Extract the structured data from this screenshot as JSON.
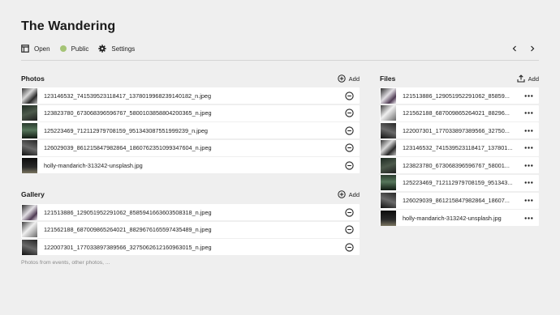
{
  "page": {
    "title": "The Wandering"
  },
  "toolbar": {
    "open_label": "Open",
    "public_label": "Public",
    "settings_label": "Settings",
    "status_color": "#a5c476"
  },
  "photos": {
    "title": "Photos",
    "add_label": "Add",
    "items": [
      {
        "name": "123146532_741539523118417_1378019968239140182_n.jpeg",
        "thumb": "t1"
      },
      {
        "name": "123823780_673068396596767_5800103858804200365_n.jpeg",
        "thumb": "t2"
      },
      {
        "name": "125223469_712112979708159_951343087551999239_n.jpeg",
        "thumb": "t3"
      },
      {
        "name": "126029039_861215847982864_1860762351099347604_n.jpeg",
        "thumb": "t4"
      },
      {
        "name": "holly-mandarich-313242-unsplash.jpg",
        "thumb": "t5"
      }
    ]
  },
  "gallery": {
    "title": "Gallery",
    "add_label": "Add",
    "caption": "Photos from events, other photos, ...",
    "items": [
      {
        "name": "121513886_129051952291062_8585941663603508318_n.jpeg",
        "thumb": "t6"
      },
      {
        "name": "121562188_687009865264021_8829676165597435489_n.jpeg",
        "thumb": "t7"
      },
      {
        "name": "122007301_177033897389566_3275062612160963015_n.jpeg",
        "thumb": "t4"
      }
    ]
  },
  "files": {
    "title": "Files",
    "add_label": "Add",
    "items": [
      {
        "name": "121513886_129051952291062_85859...",
        "thumb": "t6"
      },
      {
        "name": "121562188_687009865264021_88296...",
        "thumb": "t7"
      },
      {
        "name": "122007301_177033897389566_32750...",
        "thumb": "t4"
      },
      {
        "name": "123146532_741539523118417_137801...",
        "thumb": "t1"
      },
      {
        "name": "123823780_673068396596767_58001...",
        "thumb": "t2"
      },
      {
        "name": "125223469_712112979708159_951343...",
        "thumb": "t3"
      },
      {
        "name": "126029039_861215847982864_18607...",
        "thumb": "t4"
      },
      {
        "name": "holly-mandarich-313242-unsplash.jpg",
        "thumb": "t5"
      }
    ]
  }
}
